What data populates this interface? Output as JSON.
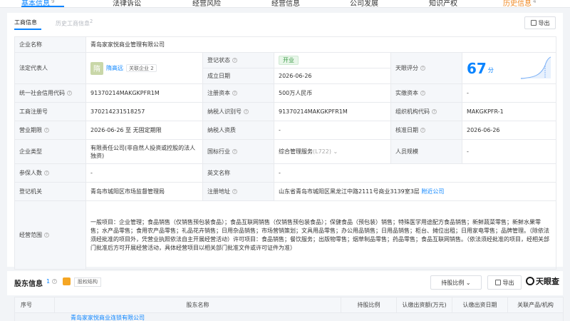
{
  "top_tabs": [
    {
      "label": "基本信息",
      "count": "9"
    },
    {
      "label": "法律诉讼"
    },
    {
      "label": "经营风险"
    },
    {
      "label": "经营信息"
    },
    {
      "label": "公司发展"
    },
    {
      "label": "知识产权"
    },
    {
      "label": "历史信息",
      "count": "4"
    }
  ],
  "section": {
    "active_tab": "工商信息",
    "inactive_tab": "历史工商信息",
    "inactive_count": "2",
    "export_label": "导出"
  },
  "company": {
    "name_label": "企业名称",
    "name": "青岛家家悦商业管理有限公司",
    "rep_label": "法定代表人",
    "rep_avatar": "隋",
    "rep_name": "隋高远",
    "rep_assoc": "关联企业 2",
    "status_label": "登记状态",
    "status": "开业",
    "found_label": "成立日期",
    "found": "2026-06-26",
    "score_label": "天眼评分",
    "score": "67",
    "score_unit": "分",
    "credit_label": "统一社会信用代码",
    "credit": "91370214MAKGKPFR1M",
    "capital_label": "注册资本",
    "capital": "500万人民币",
    "paid_label": "实缴资本",
    "paid": "-",
    "reg_no_label": "工商注册号",
    "reg_no": "370214231518257",
    "tax_label": "纳税人识别号",
    "tax": "91370214MAKGKPFR1M",
    "org_label": "组织机构代码",
    "org": "MAKGKPFR-1",
    "term_label": "营业期限",
    "term": "2026-06-26 至 无固定期限",
    "taxq_label": "纳税人资质",
    "taxq": "-",
    "approve_label": "核准日期",
    "approve": "2026-06-26",
    "type_label": "企业类型",
    "type": "有限责任公司(非自然人投资或控股的法人独资)",
    "industry_label": "国标行业",
    "industry": "综合管理服务",
    "industry_code": "(L722)",
    "staff_label": "人员规模",
    "staff": "-",
    "insured_label": "参保人数",
    "insured": "-",
    "en_label": "英文名称",
    "en": "-",
    "authority_label": "登记机关",
    "authority": "青岛市城阳区市场监督管理局",
    "addr_label": "注册地址",
    "addr": "山东省青岛市城阳区黑龙江中路2111号商业3139室3层",
    "addr_link": "附近公司",
    "scope_label": "经营范围",
    "scope": "一般项目：企业管理；食品销售（仅销售预包装食品）；食品互联网销售（仅销售预包装食品）；保健食品（预包装）销售；特殊医学用途配方食品销售；新鲜蔬菜零售；新鲜水果零售；水产品零售；食用农产品零售；礼品花卉销售；日用杂品销售；市场营销策划；文具用品零售；办公用品销售；日用品销售；柜台、摊位出租；日用家电零售；品牌管理。（除依法须经批准的项目外，凭营业执照依法自主开展经营活动）许可项目：食品销售；餐饮服务；出版物零售；烟草制品零售；药品零售；食品互联网销售。（依法须经批准的项目，经相关部门批准后方可开展经营活动，具体经营项目以相关部门批准文件或许可证件为准）"
  },
  "shareholders": {
    "title": "股东信息",
    "count": "1",
    "structure_label": "股权结构",
    "ratio_label": "持股比例",
    "export_label": "导出",
    "brand": "天眼查",
    "columns": [
      "序号",
      "股东名称",
      "持股比例",
      "认缴出资额(万元)",
      "认缴出资日期",
      "关联产品/机构"
    ],
    "first_row_name": "青岛家家悦商业连锁有限公司"
  }
}
